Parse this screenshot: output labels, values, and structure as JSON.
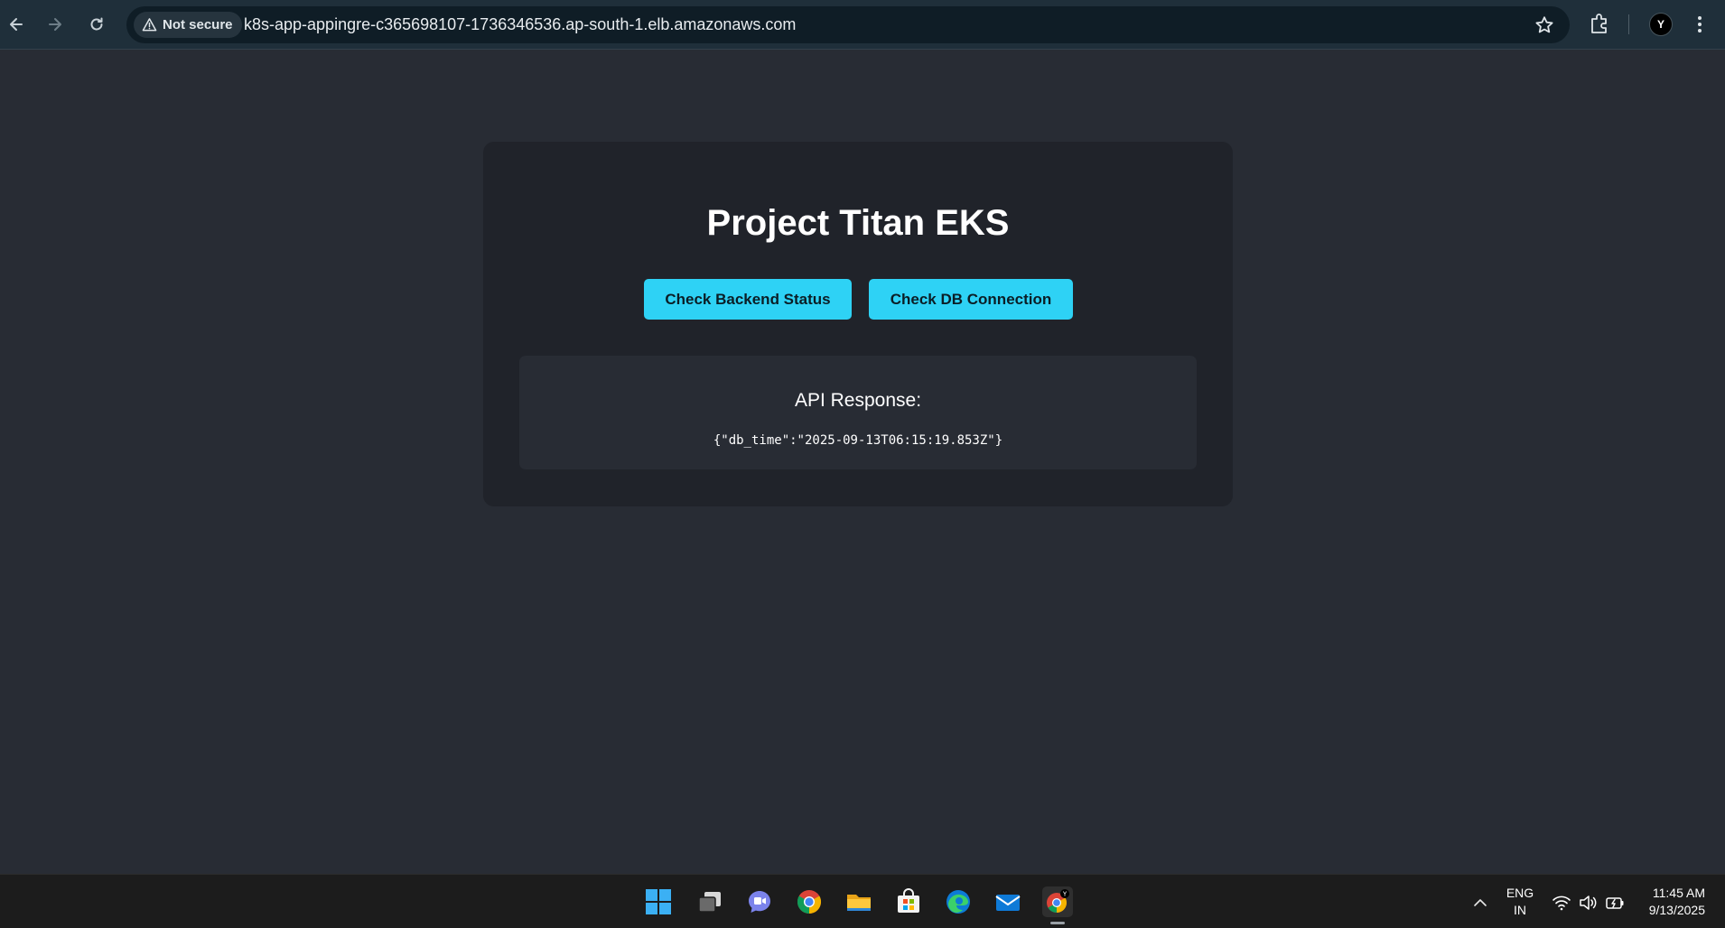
{
  "browser": {
    "security_label": "Not secure",
    "url": "k8s-app-appingre-c365698107-1736346536.ap-south-1.elb.amazonaws.com",
    "profile_initial": "Y"
  },
  "page": {
    "title": "Project Titan EKS",
    "buttons": {
      "backend_status": "Check Backend Status",
      "db_connection": "Check DB Connection"
    },
    "response": {
      "heading": "API Response:",
      "body": "{\"db_time\":\"2025-09-13T06:15:19.853Z\"}"
    },
    "colors": {
      "background": "#282c34",
      "card": "#20232a",
      "button": "#2ed2f5"
    }
  },
  "taskbar": {
    "apps": [
      "windows-start-icon",
      "task-view-icon",
      "teams-chat-icon",
      "chrome-icon",
      "file-explorer-icon",
      "microsoft-store-icon",
      "edge-icon",
      "mail-icon",
      "chrome-profile-icon"
    ],
    "language_line1": "ENG",
    "language_line2": "IN",
    "time": "11:45 AM",
    "date": "9/13/2025"
  }
}
